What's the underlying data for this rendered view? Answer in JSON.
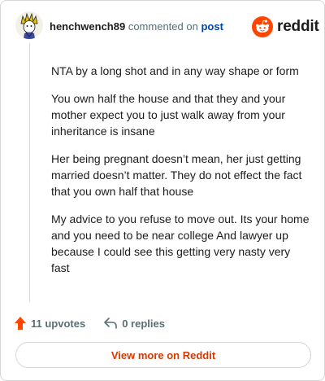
{
  "comment": {
    "username": "henchwench89",
    "action_text": "commented on",
    "post_link": "post",
    "paragraphs": [
      "NTA by a long shot and in any way shape or form",
      "You own half the house and that they and your mother expect you to just walk away from your inheritance is insane",
      "Her being pregnant doesn’t mean, her just getting married doesn’t matter. They do not effect the fact that you own half that house",
      "My advice to you refuse to move out. Its your home and you need to be near college And lawyer up because I could see this getting very nasty very fast"
    ]
  },
  "brand": {
    "name": "reddit",
    "accent": "#ff4500"
  },
  "actions": {
    "upvotes_label": "11 upvotes",
    "replies_label": "0 replies"
  },
  "footer": {
    "view_more_label": "View more on Reddit"
  },
  "icons": [
    "avatar",
    "reddit-logo-icon",
    "upvote-arrow-icon",
    "reply-arrow-icon"
  ]
}
